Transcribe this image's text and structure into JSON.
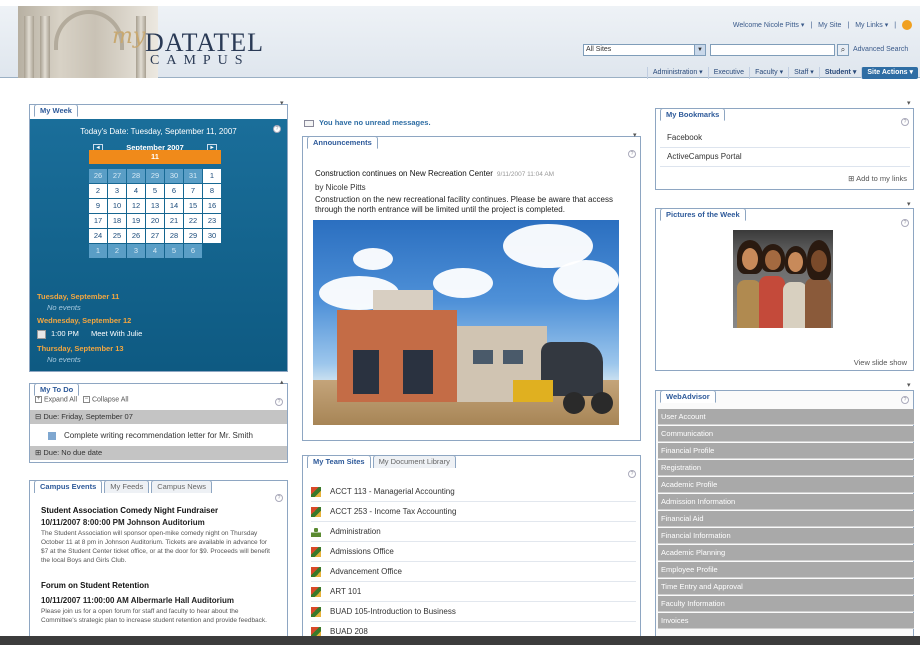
{
  "header": {
    "logo_my": "my",
    "logo_main": "DATATEL",
    "logo_sub": "CAMPUS",
    "welcome": "Welcome Nicole Pitts ▾",
    "my_site": "My Site",
    "my_links": "My Links ▾",
    "sites_select": "All Sites",
    "advanced_search": "Advanced Search",
    "nav": [
      "Administration ▾",
      "Executive",
      "Faculty ▾",
      "Staff ▾",
      "Student ▾"
    ],
    "site_actions": "Site Actions ▾"
  },
  "my_week": {
    "title": "My Week",
    "today_label": "Today's Date:  Tuesday, September 11, 2007",
    "month": "September 2007",
    "day_headers": [
      "S",
      "M",
      "T",
      "W",
      "T",
      "F",
      "S"
    ],
    "days": [
      {
        "n": "26",
        "other": true
      },
      {
        "n": "27",
        "other": true
      },
      {
        "n": "28",
        "other": true
      },
      {
        "n": "29",
        "other": true
      },
      {
        "n": "30",
        "other": true
      },
      {
        "n": "31",
        "other": true
      },
      {
        "n": "1"
      },
      {
        "n": "2"
      },
      {
        "n": "3"
      },
      {
        "n": "4"
      },
      {
        "n": "5"
      },
      {
        "n": "6"
      },
      {
        "n": "7"
      },
      {
        "n": "8"
      },
      {
        "n": "9"
      },
      {
        "n": "10"
      },
      {
        "n": "11",
        "today": true
      },
      {
        "n": "12"
      },
      {
        "n": "13"
      },
      {
        "n": "14"
      },
      {
        "n": "15"
      },
      {
        "n": "16"
      },
      {
        "n": "17"
      },
      {
        "n": "18"
      },
      {
        "n": "19"
      },
      {
        "n": "20"
      },
      {
        "n": "21"
      },
      {
        "n": "22"
      },
      {
        "n": "23"
      },
      {
        "n": "24"
      },
      {
        "n": "25"
      },
      {
        "n": "26"
      },
      {
        "n": "27"
      },
      {
        "n": "28"
      },
      {
        "n": "29"
      },
      {
        "n": "30"
      },
      {
        "n": "1",
        "other": true
      },
      {
        "n": "2",
        "other": true
      },
      {
        "n": "3",
        "other": true
      },
      {
        "n": "4",
        "other": true
      },
      {
        "n": "5",
        "other": true
      },
      {
        "n": "6",
        "other": true
      }
    ],
    "events": {
      "day1": "Tuesday, September 11",
      "day1_none": "No events",
      "day2": "Wednesday, September 12",
      "day2_time": "1:00 PM",
      "day2_event": "Meet With Julie",
      "day3": "Thursday, September 13",
      "day3_none": "No events"
    }
  },
  "todo": {
    "title": "My To Do",
    "expand": "Expand All",
    "collapse": "Collapse All",
    "group1": "Due: Friday, September 07",
    "item1": "Complete writing recommendation letter for Mr. Smith",
    "group2": "Due: No due date"
  },
  "campus": {
    "tabs": [
      "Campus Events",
      "My Feeds",
      "Campus News"
    ],
    "items": [
      {
        "title": "Student Association Comedy Night Fundraiser",
        "date": "10/11/2007 8:00:00 PM Johnson Auditorium",
        "body": "The Student Association will sponsor open-mike comedy night on Thursday October 11 at 8 pm in Johnson Auditorium. Tickets are available in advance for $7 at the Student Center ticket office, or at the door for $9.  Proceeds will benefit the local Boys and Girls Club."
      },
      {
        "title": "Forum on Student Retention",
        "date": "10/11/2007 11:00:00 AM Albermarle Hall Auditorium",
        "body": "Please join us for a open forum for staff and faculty to hear about the Committee's strategic plan to increase student retention and provide feedback."
      }
    ]
  },
  "messages": "You have no unread messages.",
  "announcements": {
    "title": "Announcements",
    "headline": "Construction continues on New Recreation Center",
    "date": "9/11/2007 11:04 AM",
    "by": "by Nicole Pitts",
    "body": "Construction on the  new recreational facility continues.  Please be aware that access through the north entrance will be limited until the project is completed."
  },
  "team_sites": {
    "tabs": [
      "My Team Sites",
      "My Document Library"
    ],
    "items": [
      "ACCT 113 - Managerial Accounting",
      "ACCT 253 - Income Tax Accounting",
      "Administration",
      "Admissions Office",
      "Advancement Office",
      "ART 101",
      "BUAD 105-Introduction to Business",
      "BUAD 208"
    ]
  },
  "bookmarks": {
    "title": "My Bookmarks",
    "items": [
      "Facebook",
      "ActiveCampus Portal"
    ],
    "add": "Add to my links"
  },
  "pictures": {
    "title": "Pictures of the Week",
    "slideshow": "View slide show"
  },
  "webadvisor": {
    "title": "WebAdvisor",
    "items": [
      "User Account",
      "Communication",
      "Financial Profile",
      "Registration",
      "Academic Profile",
      "Admission Information",
      "Financial Aid",
      "Financial Information",
      "Academic Planning",
      "Employee Profile",
      "Time Entry and Approval",
      "Faculty Information",
      "Invoices"
    ]
  },
  "colors": {
    "week_bg": "#1a6e9a",
    "accent": "#2e6da4",
    "event_day": "#f2a640",
    "webadvisor_item": "#a9a9a9"
  }
}
